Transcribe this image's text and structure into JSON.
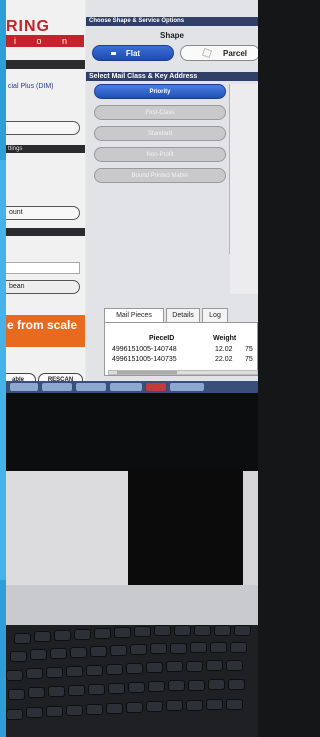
{
  "left_panel": {
    "logo_top": "RING",
    "logo_bottom": "i o n",
    "service_text": "cial Plus (DIM)",
    "settings_label": "ttings",
    "ount_button": "ount",
    "bean_button": "bean",
    "orange_banner": "e from scale",
    "able_button": "able",
    "rescan_button": "RESCAN"
  },
  "center": {
    "shape_header": "Choose Shape & Service Options",
    "shape_title": "Shape",
    "shape_flat": "Flat",
    "shape_parcel": "Parcel",
    "mail_class_header": "Select Mail Class & Key Address",
    "mail_classes": [
      "Priority",
      "First-Class",
      "Standard",
      "Non-Profit",
      "Bound Printed Matter"
    ]
  },
  "tabs": [
    "Mail Pieces",
    "Details",
    "Log"
  ],
  "table": {
    "columns": [
      "PieceID",
      "Weight"
    ],
    "rows": [
      {
        "piece_id": "4996151005-140748",
        "weight": "12.02",
        "extra": "75"
      },
      {
        "piece_id": "4996151005-140735",
        "weight": "22.02",
        "extra": "75"
      }
    ]
  },
  "colors": {
    "accent_blue": "#2f9ed8",
    "brand_red": "#c3232a",
    "orange": "#e86a1e",
    "header_navy": "#2f3f68"
  }
}
